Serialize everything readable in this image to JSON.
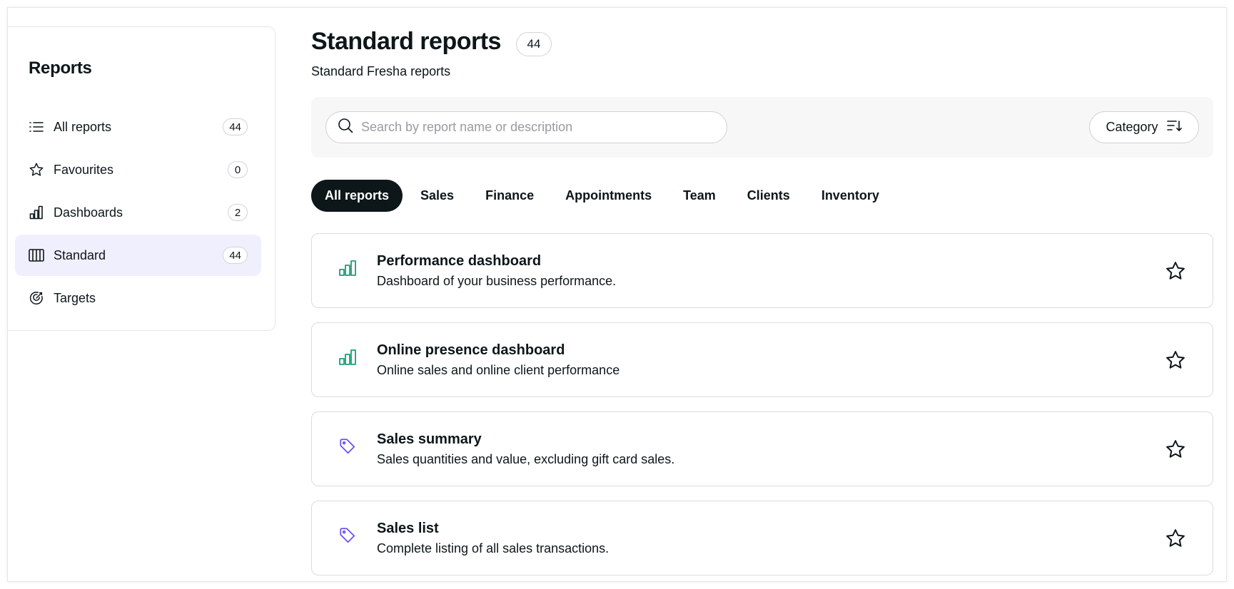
{
  "sidebar": {
    "title": "Reports",
    "items": [
      {
        "label": "All reports",
        "count": "44",
        "icon": "list-icon",
        "active": false
      },
      {
        "label": "Favourites",
        "count": "0",
        "icon": "star-icon",
        "active": false
      },
      {
        "label": "Dashboards",
        "count": "2",
        "icon": "bar-chart-icon",
        "active": false
      },
      {
        "label": "Standard",
        "count": "44",
        "icon": "columns-icon",
        "active": true
      },
      {
        "label": "Targets",
        "count": "",
        "icon": "target-icon",
        "active": false
      }
    ]
  },
  "header": {
    "title": "Standard reports",
    "count": "44",
    "subtitle": "Standard Fresha reports"
  },
  "filters": {
    "search_placeholder": "Search by report name or description",
    "search_value": "",
    "category_label": "Category"
  },
  "tabs": [
    {
      "label": "All reports",
      "active": true
    },
    {
      "label": "Sales",
      "active": false
    },
    {
      "label": "Finance",
      "active": false
    },
    {
      "label": "Appointments",
      "active": false
    },
    {
      "label": "Team",
      "active": false
    },
    {
      "label": "Clients",
      "active": false
    },
    {
      "label": "Inventory",
      "active": false
    }
  ],
  "reports": [
    {
      "title": "Performance dashboard",
      "description": "Dashboard of your business performance.",
      "icon": "dashboard-chart-icon"
    },
    {
      "title": "Online presence dashboard",
      "description": "Online sales and online client performance",
      "icon": "dashboard-chart-icon"
    },
    {
      "title": "Sales summary",
      "description": "Sales quantities and value, excluding gift card sales.",
      "icon": "tag-icon"
    },
    {
      "title": "Sales list",
      "description": "Complete listing of all sales transactions.",
      "icon": "tag-icon"
    }
  ],
  "colors": {
    "active_sidebar_bg": "#f0effd",
    "dashboard_icon": "#1a9e74",
    "tag_icon": "#6950f3",
    "active_tab_bg": "#0d1619"
  }
}
